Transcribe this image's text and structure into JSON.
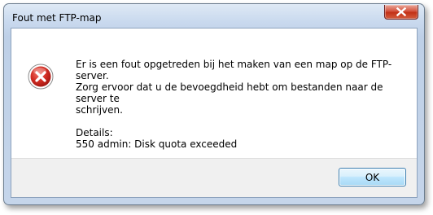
{
  "window": {
    "title": "Fout met FTP-map"
  },
  "icons": {
    "error": "error-icon",
    "close": "close-icon"
  },
  "message": {
    "line1": "Er is een fout opgetreden bij het maken van een map op de FTP-server.",
    "line2": "Zorg ervoor dat u de bevoegdheid hebt om bestanden naar de server te",
    "line3": "schrijven.",
    "details_label": "Details:",
    "details_value": "550 admin: Disk quota exceeded"
  },
  "buttons": {
    "ok": "OK"
  },
  "colors": {
    "close_button": "#c23117",
    "error_icon": "#c8211c",
    "ok_button_border": "#3c7fb1"
  }
}
